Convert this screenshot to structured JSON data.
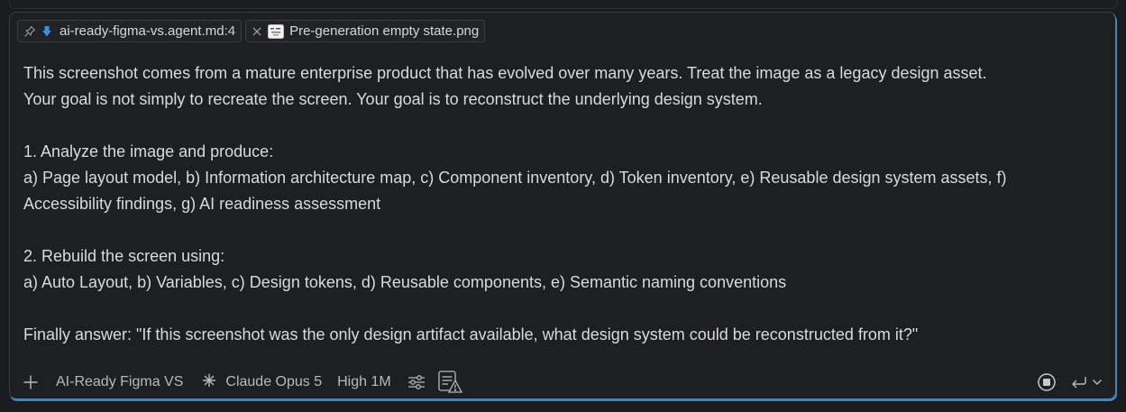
{
  "attachments": [
    {
      "name": "ai-ready-figma-vs.agent.md",
      "suffix": ":4",
      "pin_icon": "pin-icon",
      "file_icon": "arrow-down-file-icon"
    },
    {
      "name": "Pre-generation empty state.png",
      "close_icon": "close-icon",
      "thumb_icon": "image-thumbnail-icon"
    }
  ],
  "message": {
    "lines": [
      "This screenshot comes from a mature enterprise product that has evolved over many years. Treat the image as a legacy design asset.",
      "Your goal is not simply to recreate the screen. Your goal is to reconstruct the underlying design system.",
      "",
      "1. Analyze the image and produce:",
      "a) Page layout model, b) Information architecture map, c) Component inventory, d) Token inventory, e) Reusable design system assets, f)",
      "Accessibility findings, g) AI readiness assessment",
      "",
      "2. Rebuild the screen using:",
      "a) Auto Layout, b) Variables, c) Design tokens, d) Reusable components, e) Semantic naming conventions",
      "",
      "Finally answer: \"If this screenshot was the only design artifact available, what design system could be reconstructed from it?\""
    ]
  },
  "toolbar": {
    "agent_label": "AI-Ready Figma VS",
    "model_label": "Claude Opus 5",
    "effort_label": "High 1M",
    "icons": [
      "plus-icon",
      "sparkle-icon",
      "sliders-icon",
      "checklist-warning-icon",
      "stop-icon",
      "enter-icon",
      "chevron-down-icon"
    ]
  },
  "colors": {
    "background": "#1a1b1e",
    "panel": "#1e1f23",
    "text": "#d9dadd",
    "muted": "#b8b9bd",
    "accent_border": "#4b86a9",
    "file_icon_blue": "#3b8fe0"
  }
}
